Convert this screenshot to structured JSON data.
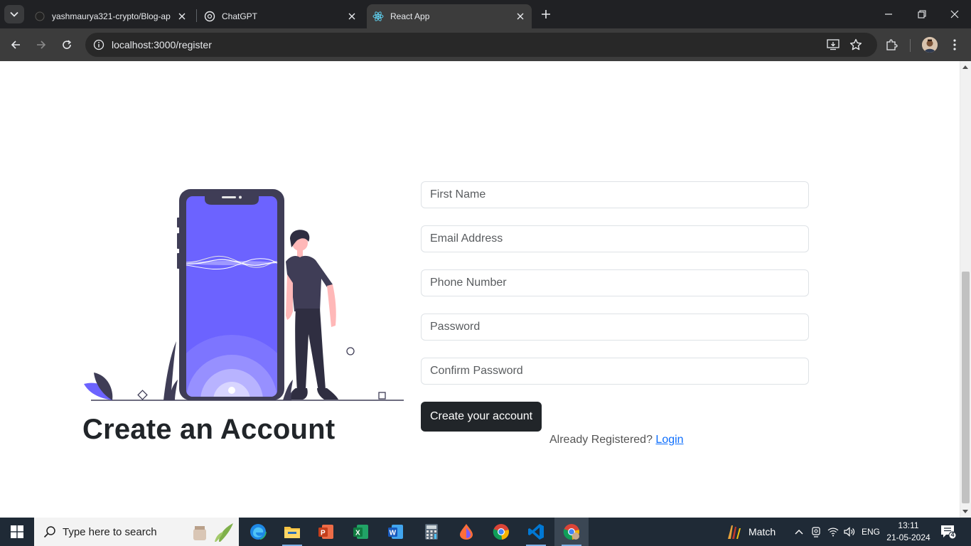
{
  "browser": {
    "tabs": [
      {
        "title": "yashmaurya321-crypto/Blog-ap",
        "favicon": "github-icon"
      },
      {
        "title": "ChatGPT",
        "favicon": "chatgpt-icon"
      },
      {
        "title": "React App",
        "favicon": "react-icon",
        "active": true
      }
    ],
    "url": "localhost:3000/register"
  },
  "page": {
    "title": "Create an Account",
    "form": {
      "first_name_placeholder": "First Name",
      "email_placeholder": "Email Address",
      "phone_placeholder": "Phone Number",
      "password_placeholder": "Password",
      "confirm_password_placeholder": "Confirm Password",
      "submit_label": "Create your account",
      "already_registered_text": "Already Registered?",
      "login_link_text": "Login"
    },
    "colors": {
      "accent": "#6c63ff",
      "button": "#212529",
      "link": "#0d6efd"
    }
  },
  "taskbar": {
    "search_placeholder": "Type here to search",
    "apps": [
      "edge-icon",
      "file-explorer-icon",
      "powerpoint-icon",
      "excel-icon",
      "word-icon",
      "calculator-icon",
      "paint-icon",
      "chrome-icon",
      "vscode-icon",
      "chrome-active-icon"
    ],
    "weather_text": "Match",
    "language": "ENG",
    "time": "13:11",
    "date": "21-05-2024",
    "notification_count": "4"
  }
}
